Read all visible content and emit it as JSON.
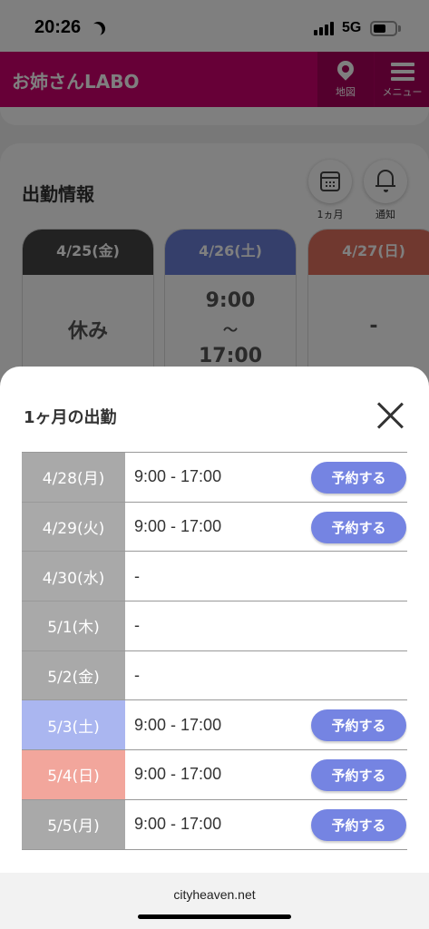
{
  "status_bar": {
    "time": "20:26",
    "network": "5G"
  },
  "header": {
    "logo": "お姉さんLABO",
    "map_label": "地図",
    "menu_label": "メニュー"
  },
  "page": {
    "section_title": "出勤情報",
    "monthly_label": "1ヵ月",
    "notify_label": "通知",
    "days": [
      {
        "date": "4/25(金)",
        "body": "休み",
        "color": "#444444"
      },
      {
        "date": "4/26(土)",
        "body": "9:00",
        "body2": "〜",
        "body3": "17:00",
        "color": "#6a7fd6"
      },
      {
        "date": "4/27(日)",
        "body": "-",
        "color": "#e0705f"
      }
    ]
  },
  "sheet": {
    "title": "1ヶ月の出勤",
    "reserve_label": "予約する",
    "rows": [
      {
        "date": "4/28(月)",
        "time": "9:00 - 17:00",
        "reservable": true,
        "color": "#a9a9a9"
      },
      {
        "date": "4/29(火)",
        "time": "9:00 - 17:00",
        "reservable": true,
        "color": "#a9a9a9"
      },
      {
        "date": "4/30(水)",
        "time": "-",
        "reservable": false,
        "color": "#a9a9a9"
      },
      {
        "date": "5/1(木)",
        "time": "-",
        "reservable": false,
        "color": "#a9a9a9"
      },
      {
        "date": "5/2(金)",
        "time": "-",
        "reservable": false,
        "color": "#a9a9a9"
      },
      {
        "date": "5/3(土)",
        "time": "9:00 - 17:00",
        "reservable": true,
        "color": "#aab6f0"
      },
      {
        "date": "5/4(日)",
        "time": "9:00 - 17:00",
        "reservable": true,
        "color": "#f2a69c"
      },
      {
        "date": "5/5(月)",
        "time": "9:00 - 17:00",
        "reservable": true,
        "color": "#a9a9a9"
      }
    ]
  },
  "footer": {
    "domain": "cityheaven.net"
  },
  "colors": {
    "accent": "#cf006e",
    "button": "#7584e2"
  },
  "icons": [
    "moon-icon",
    "signal-icon",
    "battery-icon",
    "map-pin-icon",
    "hamburger-icon",
    "calendar-icon",
    "bell-icon",
    "close-icon"
  ]
}
